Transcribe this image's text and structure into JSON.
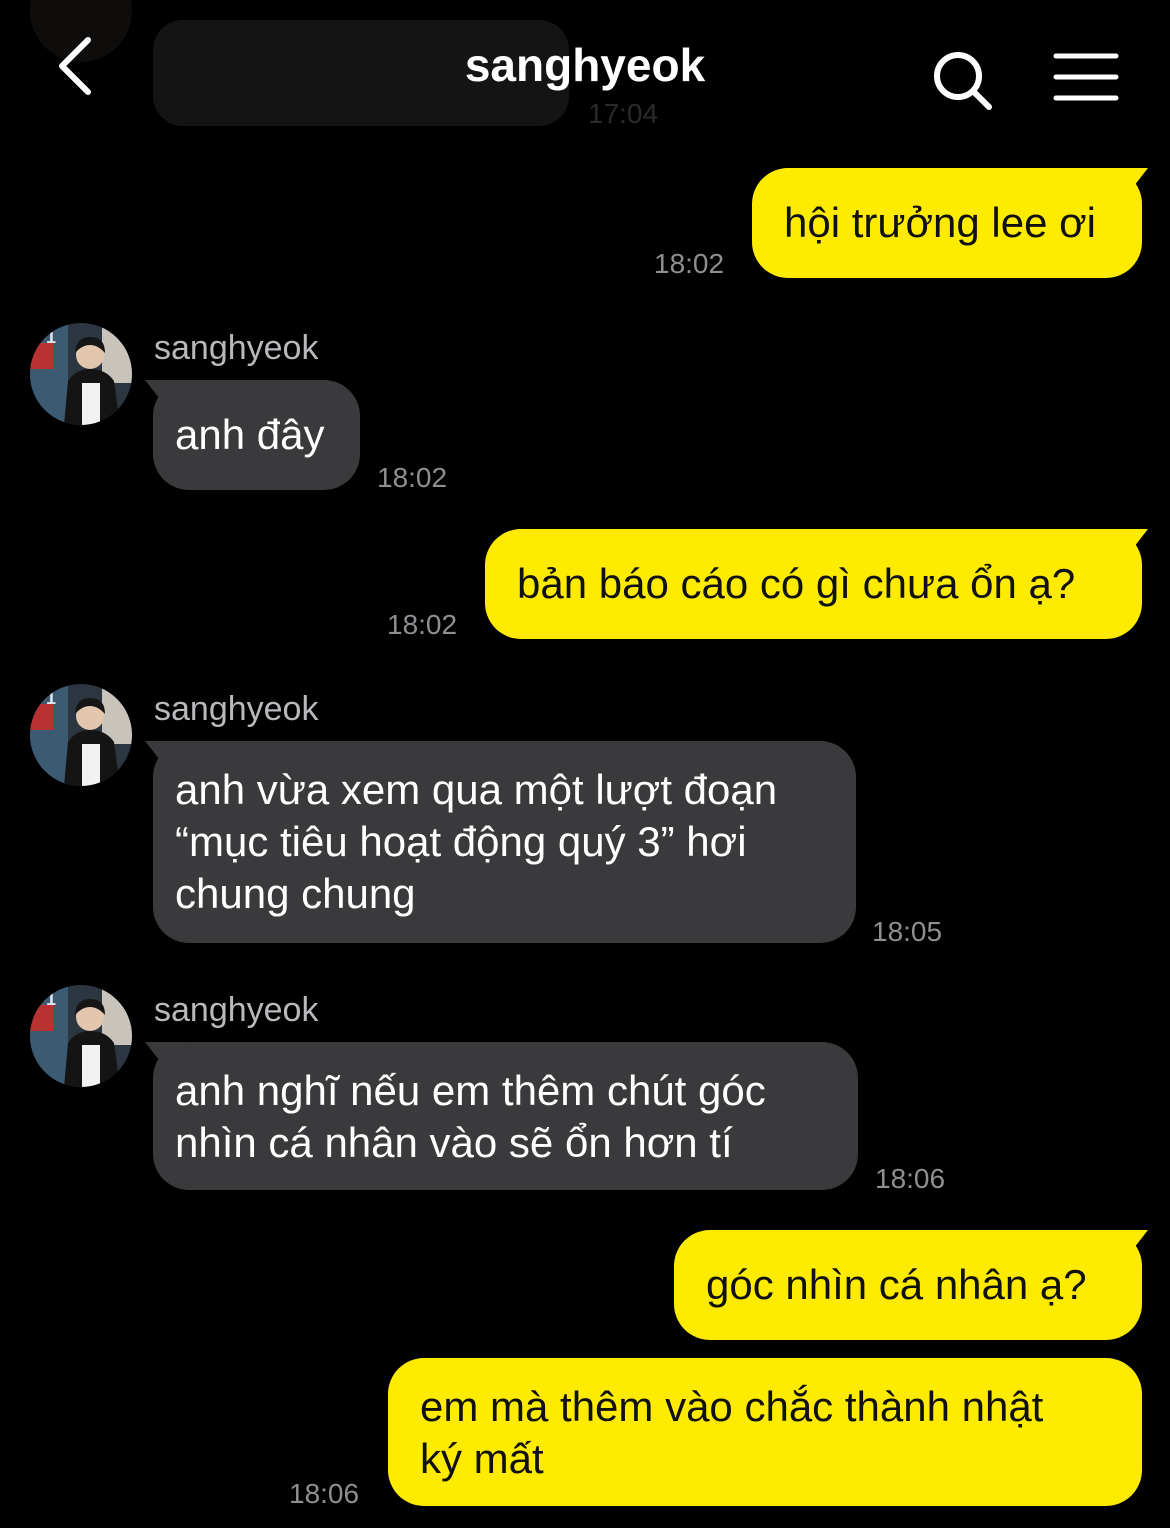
{
  "header": {
    "title": "sanghyeok",
    "back_icon": "chevron-left-icon",
    "search_icon": "search-icon",
    "menu_icon": "hamburger-menu-icon"
  },
  "previous_message_partial": {
    "time": "17:04"
  },
  "colors": {
    "background": "#000000",
    "outgoing_bubble": "#ffeb00",
    "incoming_bubble": "#3a3a3c",
    "timestamp": "#8e8e93",
    "sender_name": "#b8b8bd"
  },
  "messages": [
    {
      "direction": "out",
      "lines": [
        "hội trưởng lee ơi"
      ],
      "time": "18:02"
    },
    {
      "direction": "in",
      "sender": "sanghyeok",
      "lines": [
        "anh đây"
      ],
      "time": "18:02"
    },
    {
      "direction": "out",
      "lines": [
        "bản báo cáo có gì chưa ổn ạ?"
      ],
      "time": "18:02"
    },
    {
      "direction": "in",
      "sender": "sanghyeok",
      "lines": [
        "anh vừa xem qua một lượt đoạn",
        "“mục tiêu hoạt động quý 3” hơi",
        "chung chung"
      ],
      "time": "18:05"
    },
    {
      "direction": "in",
      "sender": "sanghyeok",
      "lines": [
        "anh nghĩ nếu em thêm chút góc",
        "nhìn cá nhân vào sẽ ổn hơn tí"
      ],
      "time": "18:06"
    },
    {
      "direction": "out",
      "lines": [
        "góc nhìn cá nhân ạ?"
      ]
    },
    {
      "direction": "out",
      "lines": [
        "em mà thêm vào chắc thành nhật",
        "ký mất"
      ],
      "time": "18:06"
    }
  ]
}
